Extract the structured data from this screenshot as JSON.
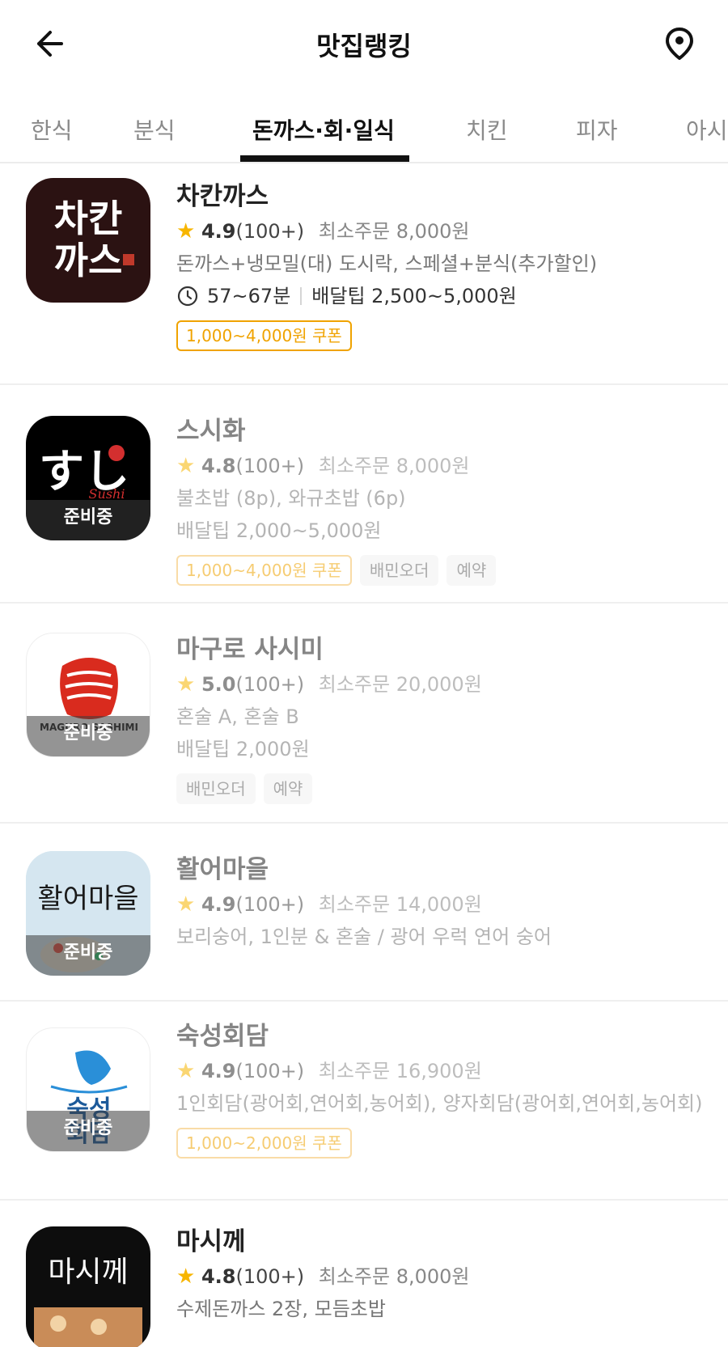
{
  "header": {
    "title": "맛집랭킹",
    "back_icon": "arrow-left-icon",
    "location_icon": "map-pin-icon"
  },
  "tabs": [
    {
      "label": "한식"
    },
    {
      "label": "분식"
    },
    {
      "label": "돈까스·회·일식",
      "active": true
    },
    {
      "label": "치킨"
    },
    {
      "label": "피자"
    },
    {
      "label": "아시"
    }
  ],
  "restaurants": [
    {
      "name": "차칸까스",
      "logo_text": "차칸\n까스",
      "rating": "4.9",
      "reviews": "(100+)",
      "min_order": "최소주문 8,000원",
      "menu": "돈까스+냉모밀(대) 도시락, 스페셜+분식(추가할인)",
      "time": "57~67분",
      "tip": "배달팁 2,500~5,000원",
      "coupon": "1,000~4,000원 쿠폰"
    },
    {
      "name": "스시화",
      "logo_text": "すし",
      "logo_sub": "Sushi",
      "status": "준비중",
      "rating": "4.8",
      "reviews": "(100+)",
      "min_order": "최소주문 8,000원",
      "menu": "불초밥 (8p), 와규초밥 (6p)",
      "tip": "배달팁 2,000~5,000원",
      "coupon": "1,000~4,000원 쿠폰",
      "chips": [
        "배민오더",
        "예약"
      ]
    },
    {
      "name": "마구로 사시미",
      "logo_text": "MAGURO SASHIMI",
      "status": "준비중",
      "rating": "5.0",
      "reviews": "(100+)",
      "min_order": "최소주문 20,000원",
      "menu": "혼술 A, 혼술 B",
      "tip": "배달팁 2,000원",
      "chips": [
        "배민오더",
        "예약"
      ]
    },
    {
      "name": "활어마을",
      "logo_text": "활어마을",
      "status": "준비중",
      "rating": "4.9",
      "reviews": "(100+)",
      "min_order": "최소주문 14,000원",
      "menu": "보리숭어, 1인분 & 혼술 / 광어 우럭 연어 숭어"
    },
    {
      "name": "숙성회담",
      "logo_text": "숙성\n회담",
      "status": "준비중",
      "rating": "4.9",
      "reviews": "(100+)",
      "min_order": "최소주문 16,900원",
      "menu": "1인회담(광어회,연어회,농어회), 양자회담(광어회,연어회,농어회)",
      "coupon": "1,000~2,000원 쿠폰"
    },
    {
      "name": "마시께",
      "logo_text": "마시께",
      "rating": "4.8",
      "reviews": "(100+)",
      "min_order": "최소주문 8,000원",
      "menu": "수제돈까스 2장, 모듬초밥"
    }
  ],
  "colors": {
    "accent_coupon": "#f0a300",
    "star": "#f7b500",
    "tab_indicator": "#111111"
  }
}
